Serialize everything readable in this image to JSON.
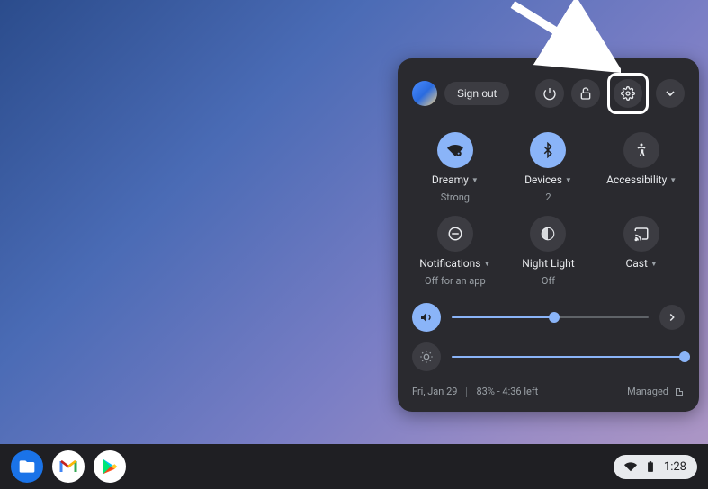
{
  "header": {
    "signout_label": "Sign out"
  },
  "tiles": {
    "wifi": {
      "label": "Dreamy",
      "sub": "Strong"
    },
    "bluetooth": {
      "label": "Devices",
      "sub": "2"
    },
    "accessibility": {
      "label": "Accessibility"
    },
    "notifications": {
      "label": "Notifications",
      "sub": "Off for an app"
    },
    "nightlight": {
      "label": "Night Light",
      "sub": "Off"
    },
    "cast": {
      "label": "Cast"
    }
  },
  "sliders": {
    "volume_percent": 52,
    "brightness_percent": 100
  },
  "footer": {
    "date": "Fri, Jan 29",
    "battery_status": "83% - 4:36 left",
    "managed_label": "Managed"
  },
  "tray": {
    "time": "1:28"
  }
}
